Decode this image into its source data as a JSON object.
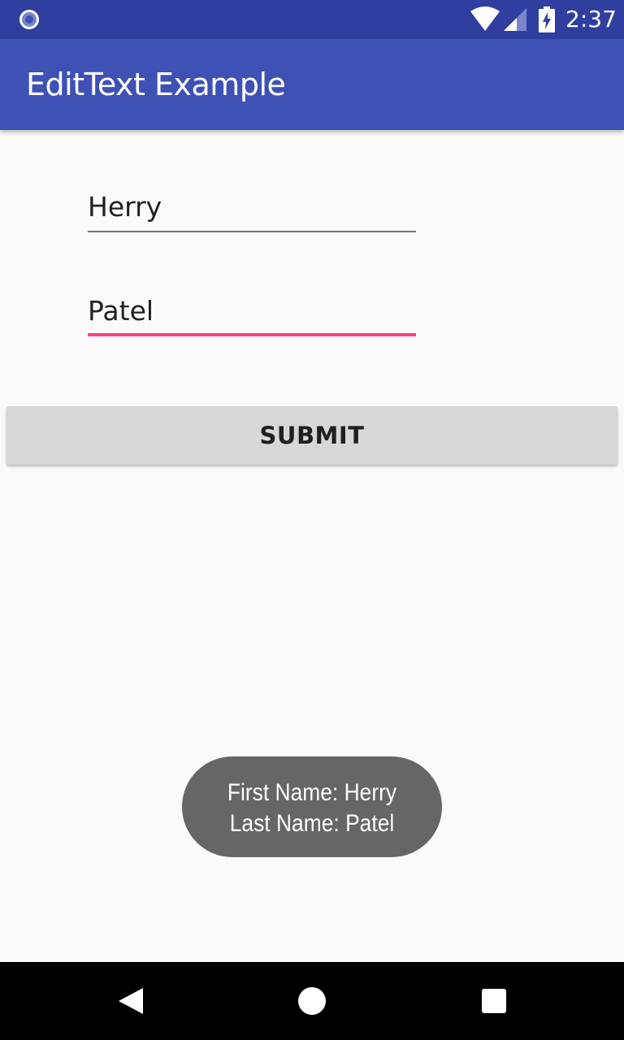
{
  "status_bar": {
    "time": "2:37",
    "icons": [
      "notification-circle-icon",
      "wifi-icon",
      "cell-signal-icon",
      "battery-charging-icon"
    ]
  },
  "app_bar": {
    "title": "EditText Example"
  },
  "form": {
    "first_name_value": "Herry",
    "last_name_value": "Patel",
    "submit_label": "SUBMIT"
  },
  "toast": {
    "line1": "First Name: Herry",
    "line2": "Last Name: Patel"
  },
  "nav_bar": {
    "icons": [
      "back-icon",
      "home-icon",
      "recents-icon"
    ]
  },
  "colors": {
    "primary": "#3f51b5",
    "primary_dark": "#303f9f",
    "accent": "#ff4081",
    "background": "#fafafa",
    "button": "#d6d7d7",
    "toast": "#666666"
  }
}
